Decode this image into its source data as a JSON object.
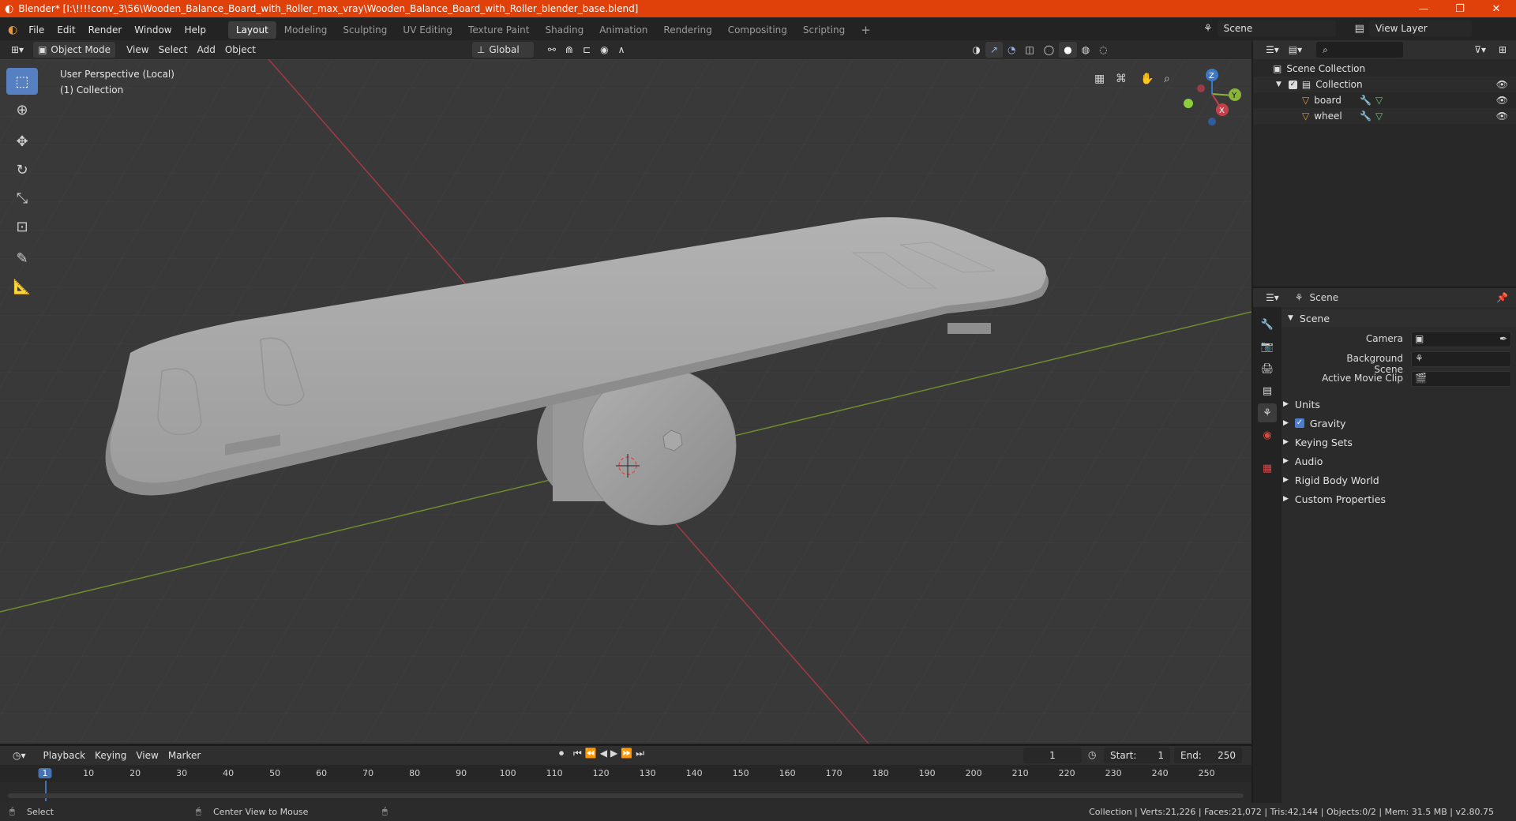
{
  "window": {
    "title": "Blender* [I:\\!!!!conv_3\\56\\Wooden_Balance_Board_with_Roller_max_vray\\Wooden_Balance_Board_with_Roller_blender_base.blend]",
    "minimize": "—",
    "maximize": "❐",
    "close": "✕"
  },
  "menu": {
    "items": [
      "File",
      "Edit",
      "Render",
      "Window",
      "Help"
    ],
    "workspaces": [
      "Layout",
      "Modeling",
      "Sculpting",
      "UV Editing",
      "Texture Paint",
      "Shading",
      "Animation",
      "Rendering",
      "Compositing",
      "Scripting"
    ],
    "active_workspace": "Layout",
    "add_workspace": "+",
    "scene": "Scene",
    "view_layer": "View Layer"
  },
  "viewport_header": {
    "mode": "Object Mode",
    "menus": [
      "View",
      "Select",
      "Add",
      "Object"
    ],
    "orientation": "Global"
  },
  "viewport": {
    "perspective": "User Perspective (Local)",
    "collection": "(1) Collection",
    "gizmo": {
      "z": "Z",
      "y": "Y",
      "x": "X"
    }
  },
  "outliner": {
    "root": "Scene Collection",
    "collection": "Collection",
    "objects": [
      "board",
      "wheel"
    ]
  },
  "properties": {
    "header": "Scene",
    "panel": "Scene",
    "fields": [
      {
        "label": "Camera"
      },
      {
        "label": "Background Scene"
      },
      {
        "label": "Active Movie Clip"
      }
    ],
    "subpanels": [
      "Units",
      "Gravity",
      "Keying Sets",
      "Audio",
      "Rigid Body World",
      "Custom Properties"
    ],
    "gravity_checked": true
  },
  "timeline": {
    "menus": [
      "Playback",
      "Keying",
      "View",
      "Marker"
    ],
    "current_frame": "1",
    "start_label": "Start:",
    "start": "1",
    "end_label": "End:",
    "end": "250",
    "ruler": [
      "1",
      "10",
      "20",
      "30",
      "40",
      "50",
      "60",
      "70",
      "80",
      "90",
      "100",
      "110",
      "120",
      "130",
      "140",
      "150",
      "160",
      "170",
      "180",
      "190",
      "200",
      "210",
      "220",
      "230",
      "240",
      "250"
    ]
  },
  "statusbar": {
    "select": "Select",
    "center": "Center View to Mouse",
    "stats": "Collection | Verts:21,226 | Faces:21,072 | Tris:42,144 | Objects:0/2 | Mem: 31.5 MB | v2.80.75"
  },
  "colors": {
    "titlebar": "#e0400a",
    "accent": "#5680c2",
    "x_axis": "#c4404b",
    "y_axis": "#8ab33b",
    "z_axis": "#3b78c8",
    "object_icon": "#e8953a"
  }
}
